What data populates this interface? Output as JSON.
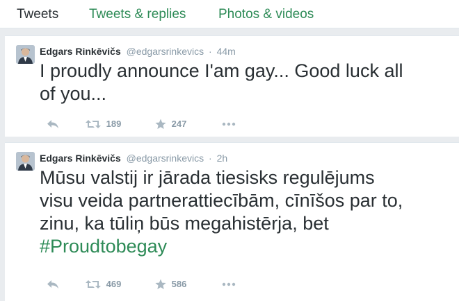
{
  "tabs": [
    {
      "label": "Tweets"
    },
    {
      "label": "Tweets & replies"
    },
    {
      "label": "Photos & videos"
    }
  ],
  "tweets": [
    {
      "name": "Edgars Rinkēvičs",
      "handle": "@edgarsrinkevics",
      "separator": "·",
      "time": "44m",
      "lines": [
        "I proudly announce I'am gay... Good luck all",
        "of you..."
      ],
      "retweets": "189",
      "favorites": "247"
    },
    {
      "name": "Edgars Rinkēvičs",
      "handle": "@edgarsrinkevics",
      "separator": "·",
      "time": "2h",
      "lines": [
        "Mūsu valstij ir jārada tiesisks regulējums",
        "visu veida partnerattiecībām, cīnīšos par to,",
        "zinu, ka tūliņ būs megahistērja, bet"
      ],
      "hashtag": "#Proudtobegay",
      "retweets": "469",
      "favorites": "586"
    }
  ],
  "icons": {
    "reply": "reply-icon",
    "retweet": "retweet-icon",
    "favorite": "star-icon",
    "more": "more-dots-icon"
  },
  "colors": {
    "link": "#2e8b57",
    "text": "#292f33",
    "muted": "#8899a6",
    "icon": "#aab8c2",
    "background": "#e9ecef"
  }
}
